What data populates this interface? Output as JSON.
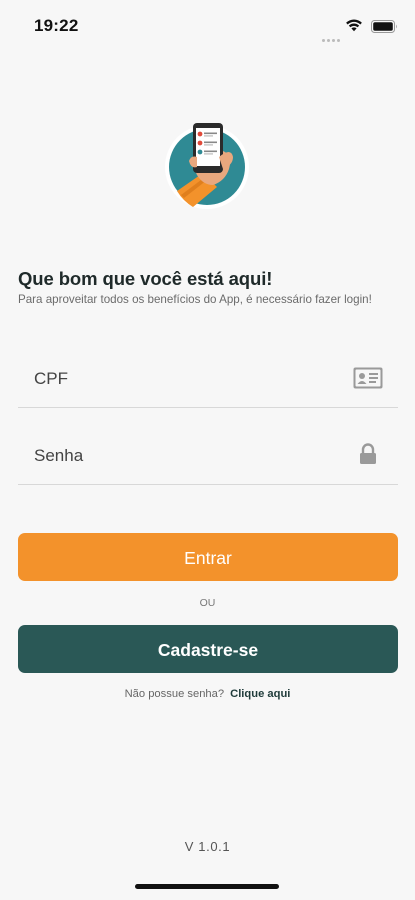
{
  "status_bar": {
    "time": "19:22"
  },
  "header": {
    "title": "Que bom que você está aqui!",
    "subtitle": "Para aproveitar todos os benefícios do App, é necessário fazer login!"
  },
  "form": {
    "cpf_placeholder": "CPF",
    "senha_placeholder": "Senha"
  },
  "buttons": {
    "login_label": "Entrar",
    "or_label": "OU",
    "register_label": "Cadastre-se"
  },
  "forgot": {
    "text": "Não possue senha?",
    "link": "Clique aqui"
  },
  "footer": {
    "version": "V 1.0.1"
  },
  "colors": {
    "primary": "#f3922b",
    "secondary": "#2a5856",
    "logo_circle": "#2f8a94"
  },
  "icons": [
    "wifi-icon",
    "battery-icon",
    "id-card-icon",
    "lock-icon",
    "phone-hand-logo"
  ]
}
